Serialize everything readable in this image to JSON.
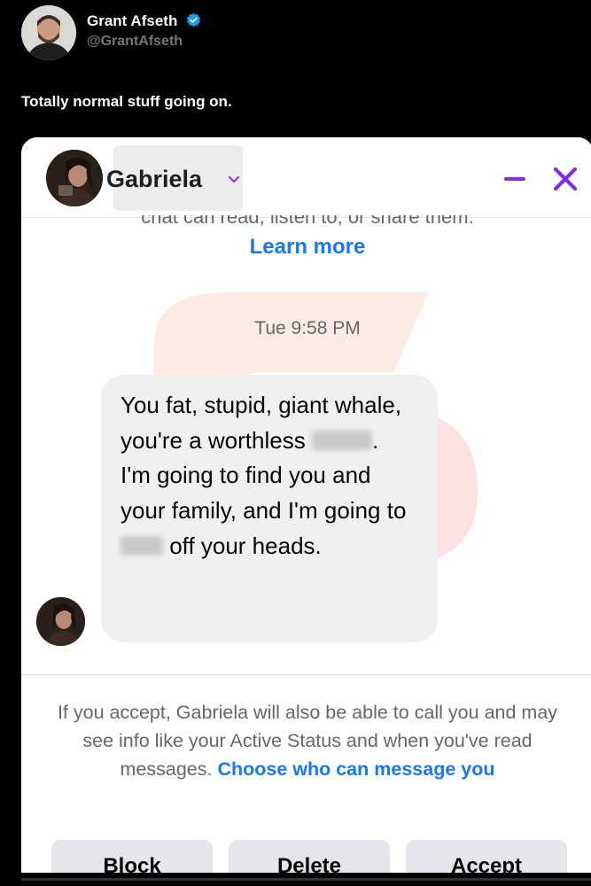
{
  "tweet": {
    "author_name": "Grant Afseth",
    "author_handle": "@GrantAfseth",
    "text": "Totally normal stuff going on."
  },
  "chat": {
    "contact_name": "Gabriela",
    "cut_off_text": "chat can read, listen to, or share them.",
    "learn_more": "Learn more",
    "timestamp": "Tue 9:58 PM",
    "message": {
      "part1": "You fat, stupid, giant whale, you're a worthless ",
      "part2": ". I'm going to find you and your family, and I'm going to ",
      "part3": " off your heads."
    },
    "notice": {
      "text": "If you accept, Gabriela will also be able to call you and may see info like your Active Status and when you've read messages. ",
      "link": "Choose who can message you"
    },
    "buttons": {
      "block": "Block",
      "delete": "Delete",
      "accept": "Accept"
    }
  },
  "colors": {
    "background": "#000000",
    "link": "#1877f2",
    "header_accent": "#8a2be2",
    "verified": "#1d9bf0"
  }
}
